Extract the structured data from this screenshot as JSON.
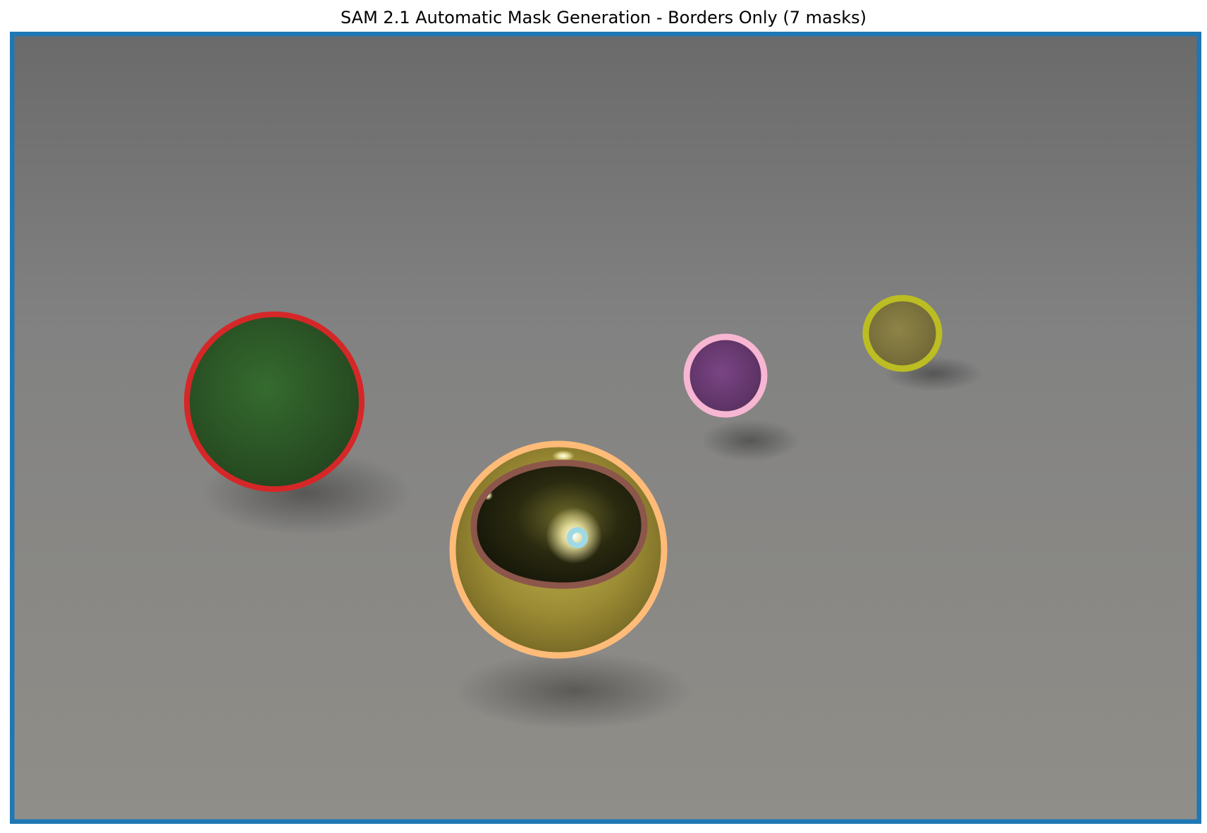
{
  "figure": {
    "title": "SAM 2.1 Automatic Mask Generation - Borders Only (7 masks)"
  },
  "scene": {
    "background_top": "#6a6a6a",
    "background_mid": "#828282",
    "background_bottom": "#908e88",
    "objects": [
      {
        "id": "green-sphere",
        "fill": "#2f5a29"
      },
      {
        "id": "gold-sphere",
        "fill": "#9a8a34"
      },
      {
        "id": "purple-sphere",
        "fill": "#6a3b72"
      },
      {
        "id": "olive-sphere",
        "fill": "#807640"
      }
    ]
  },
  "masks": [
    {
      "name": "background",
      "color": "#1f77b4"
    },
    {
      "name": "green-sphere",
      "color": "#d62728"
    },
    {
      "name": "gold-sphere",
      "color": "#ffbb78"
    },
    {
      "name": "gold-sphere-reflection",
      "color": "#8c564b"
    },
    {
      "name": "gold-sphere-highlight",
      "color": "#9edae5"
    },
    {
      "name": "purple-sphere",
      "color": "#f7b6d2"
    },
    {
      "name": "olive-sphere",
      "color": "#bcbd22"
    }
  ]
}
